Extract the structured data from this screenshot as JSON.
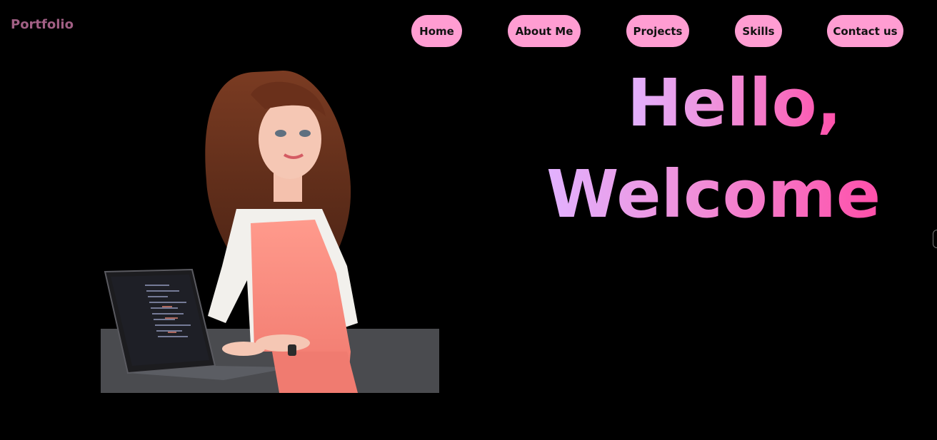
{
  "brand": {
    "label": "Portfolio"
  },
  "nav": {
    "items": [
      {
        "label": "Home"
      },
      {
        "label": "About Me"
      },
      {
        "label": "Projects"
      },
      {
        "label": "Skills"
      },
      {
        "label": "Contact us"
      }
    ]
  },
  "hero": {
    "line1": "Hello,",
    "line2": "Welcome",
    "gradient": [
      "#e2b2ff",
      "#f08ed8",
      "#ff4fa9"
    ],
    "image": {
      "icon": "illustrated-developer-portrait"
    }
  },
  "colors": {
    "background": "#000000",
    "nav_button": "#ff9dd2",
    "brand_text": "#a15f84"
  }
}
